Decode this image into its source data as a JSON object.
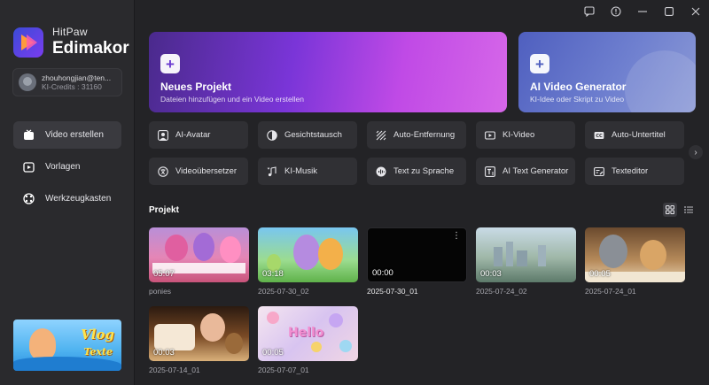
{
  "brand": {
    "sub": "HitPaw",
    "main": "Edimakor"
  },
  "user": {
    "email": "zhouhongjian@ten...",
    "credits": "KI-Credits : 31160"
  },
  "nav": [
    {
      "label": "Video erstellen",
      "icon": "video-icon",
      "active": true
    },
    {
      "label": "Vorlagen",
      "icon": "template-icon",
      "active": false
    },
    {
      "label": "Werkzeugkasten",
      "icon": "toolbox-icon",
      "active": false
    }
  ],
  "promo": {
    "line1": "Vlog",
    "line2": "Texte"
  },
  "window": {
    "icons": [
      "chat-icon",
      "info-icon",
      "minimize-icon",
      "maximize-icon",
      "close-icon"
    ]
  },
  "hero": {
    "new_project": {
      "title": "Neues Projekt",
      "subtitle": "Dateien hinzufügen und ein Video erstellen"
    },
    "ai_video": {
      "title": "AI Video Generator",
      "subtitle": "KI-Idee oder Skript zu Video"
    }
  },
  "tools": [
    {
      "label": "AI-Avatar",
      "icon": "avatar-icon"
    },
    {
      "label": "Gesichtstausch",
      "icon": "face-swap-icon"
    },
    {
      "label": "Auto-Entfernung",
      "icon": "auto-remove-icon"
    },
    {
      "label": "KI-Video",
      "icon": "ai-video-icon"
    },
    {
      "label": "Auto-Untertitel",
      "icon": "subtitle-icon"
    },
    {
      "label": "Videoübersetzer",
      "icon": "translate-icon"
    },
    {
      "label": "KI-Musik",
      "icon": "music-icon"
    },
    {
      "label": "Text zu Sprache",
      "icon": "tts-icon"
    },
    {
      "label": "AI Text Generator",
      "icon": "text-generator-icon"
    },
    {
      "label": "Texteditor",
      "icon": "text-editor-icon"
    }
  ],
  "projects": {
    "title": "Projekt",
    "items": [
      {
        "name": "ponies",
        "duration": "05:07"
      },
      {
        "name": "2025-07-30_02",
        "duration": "03:18"
      },
      {
        "name": "2025-07-30_01",
        "duration": "00:00"
      },
      {
        "name": "2025-07-24_02",
        "duration": "00:03"
      },
      {
        "name": "2025-07-24_01",
        "duration": "00:05"
      },
      {
        "name": "2025-07-14_01",
        "duration": "00:03"
      },
      {
        "name": "2025-07-07_01",
        "duration": "00:05"
      }
    ],
    "thumb_text_hello": "Hello"
  }
}
